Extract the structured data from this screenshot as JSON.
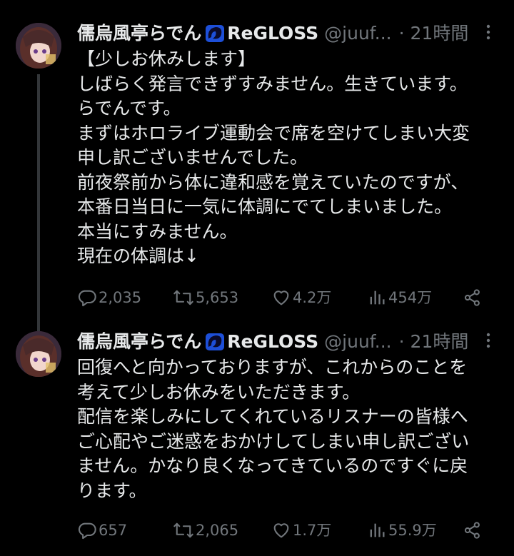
{
  "colors": {
    "background": "#000000",
    "text_primary": "#e7e9ea",
    "text_secondary": "#71767b",
    "thread_line": "#333639",
    "badge_blue": "#1d4fd8"
  },
  "tweets": [
    {
      "author": {
        "display_name": "儒烏風亭らでん",
        "affiliation": "ReGLOSS",
        "handle": "@juuf...",
        "time": "· 21時間"
      },
      "text_lines": [
        "【少しお休みします】",
        "しばらく発言できずすみません。生きています。",
        "らでんです。",
        "まずはホロライブ運動会で席を空けてしまい大変",
        "申し訳ございませんでした。",
        "前夜祭前から体に違和感を覚えていたのですが、",
        "本番日当日に一気に体調にでてしまいました。",
        "本当にすみません。",
        "現在の体調は↓"
      ],
      "stats": {
        "replies": "2,035",
        "retweets": "5,653",
        "likes": "4.2万",
        "views": "454万"
      }
    },
    {
      "author": {
        "display_name": "儒烏風亭らでん",
        "affiliation": "ReGLOSS",
        "handle": "@juuf...",
        "time": "· 21時間"
      },
      "text_lines": [
        "回復へと向かっておりますが、これからのことを",
        "考えて少しお休みをいただきます。",
        "配信を楽しみにしてくれているリスナーの皆様へ",
        "ご心配やご迷惑をおかけしてしまい申し訳ござい",
        "ません。かなり良くなってきているのですぐに戻",
        "ります。"
      ],
      "stats": {
        "replies": "657",
        "retweets": "2,065",
        "likes": "1.7万",
        "views": "55.9万"
      }
    }
  ],
  "icons": {
    "reply": "reply-icon",
    "retweet": "retweet-icon",
    "like": "heart-icon",
    "views": "views-bar-chart-icon",
    "share": "share-icon",
    "more": "more-options-icon",
    "badge": "affiliate-badge-icon"
  }
}
